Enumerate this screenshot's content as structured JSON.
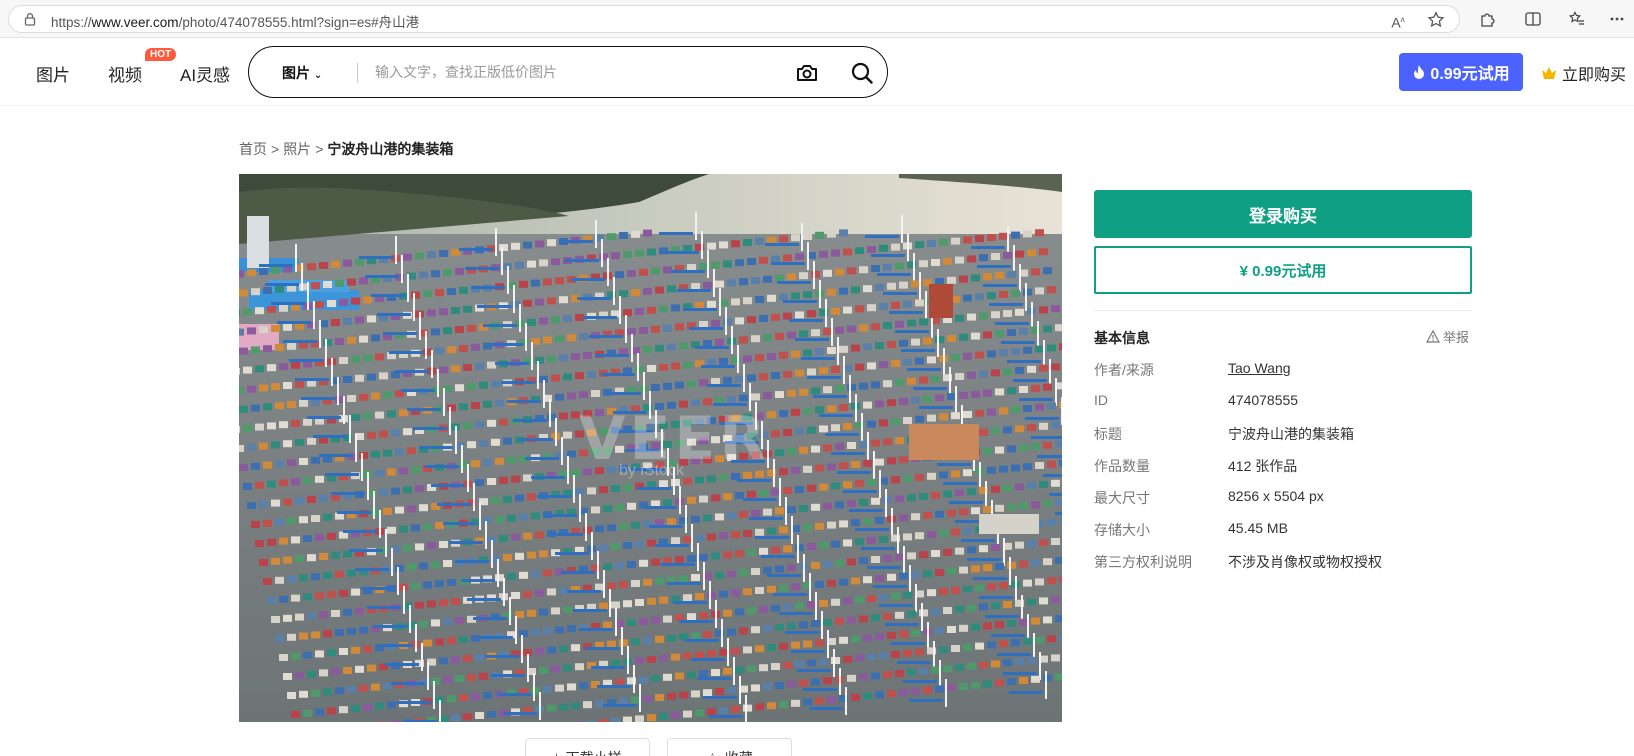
{
  "browser": {
    "url_prefix": "https://",
    "url_domain": "www.veer.com",
    "url_path": "/photo/474078555.html?sign=es#舟山港",
    "reader_icon": "read-aloud-icon",
    "star_icon": "favorite-star-icon"
  },
  "header": {
    "nav": [
      {
        "label": "图片"
      },
      {
        "label": "视频"
      },
      {
        "label": "AI灵感"
      }
    ],
    "hot_badge": "HOT",
    "search": {
      "type_label": "图片",
      "placeholder": "输入文字，查找正版低价图片"
    },
    "trial_button": "0.99元试用",
    "buy_link": "立即购买",
    "accent_color": "#4c62ff"
  },
  "breadcrumb": {
    "home": "首页",
    "category": "照片",
    "separator": ">",
    "current": "宁波舟山港的集装箱"
  },
  "photo": {
    "alt": "宁波舟山港的集装箱",
    "watermark": "VEER",
    "watermark_sub": "by iStock"
  },
  "under_photo": {
    "download_sample": "下载小样",
    "collect": "收藏"
  },
  "panel": {
    "login_buy": "登录购买",
    "trial": "¥ 0.99元试用",
    "primary_color": "#0fa083",
    "info_title": "基本信息",
    "report": "举报",
    "rows": [
      {
        "label": "作者/来源",
        "value": "Tao Wang"
      },
      {
        "label": "ID",
        "value": "474078555"
      },
      {
        "label": "标题",
        "value": "宁波舟山港的集装箱"
      },
      {
        "label": "作品数量",
        "value": "412 张作品"
      },
      {
        "label": "最大尺寸",
        "value": "8256 x 5504 px"
      },
      {
        "label": "存储大小",
        "value": "45.45 MB"
      },
      {
        "label": "第三方权利说明",
        "value": "不涉及肖像权或物权授权"
      }
    ]
  }
}
